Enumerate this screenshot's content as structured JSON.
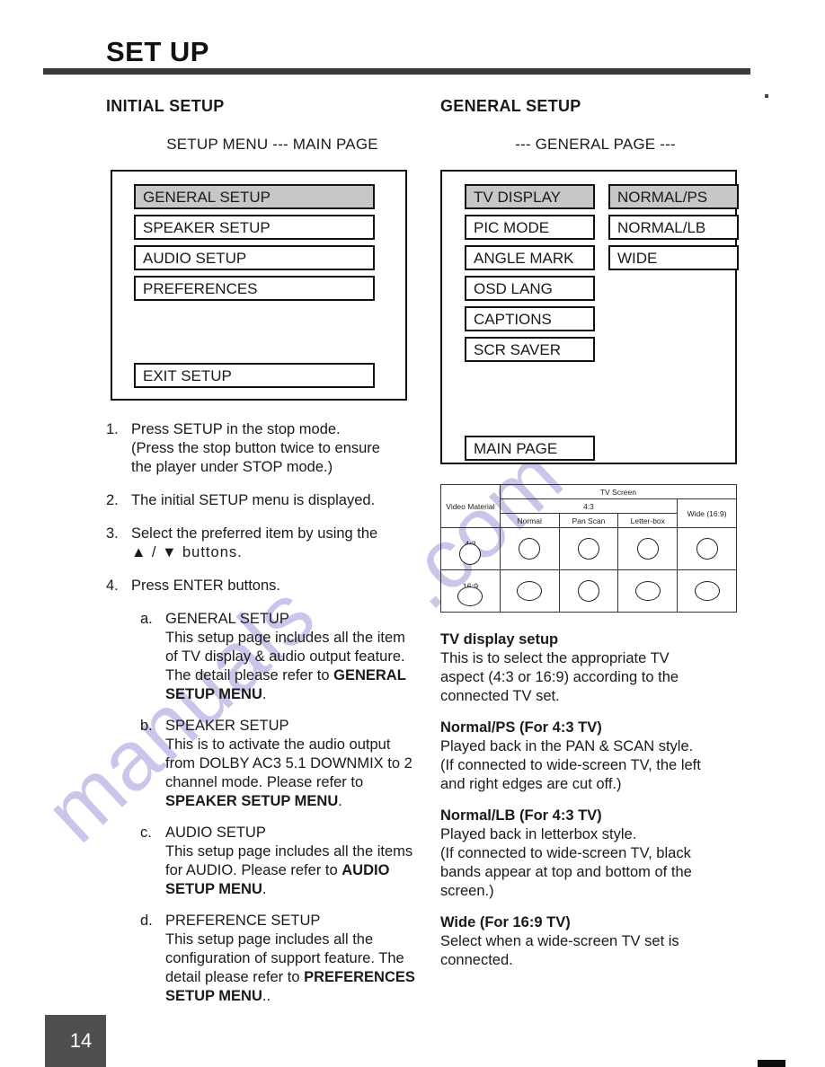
{
  "document": {
    "title": "SET UP",
    "page_number": "14"
  },
  "watermark": {
    "line1": "manuals",
    "line2": ".com"
  },
  "left_column": {
    "heading_part1": "INITIAL ",
    "heading_part2": "SETUP",
    "menu_caption": "SETUP MENU --- MAIN PAGE",
    "osd_menu": {
      "items": [
        {
          "label": "GENERAL SETUP",
          "highlighted": true
        },
        {
          "label": "SPEAKER SETUP",
          "highlighted": false
        },
        {
          "label": "AUDIO SETUP",
          "highlighted": false
        },
        {
          "label": "PREFERENCES",
          "highlighted": false
        }
      ],
      "exit_label": "EXIT SETUP"
    },
    "steps": [
      {
        "num": "1.",
        "lines": [
          "Press SETUP in the stop mode.",
          "(Press the stop button twice to ensure",
          "the player under STOP mode.)"
        ]
      },
      {
        "num": "2.",
        "lines": [
          "The initial SETUP menu is displayed."
        ]
      },
      {
        "num": "3.",
        "lines": [
          "Select the preferred item by using the",
          "▲ / ▼ buttons."
        ]
      },
      {
        "num": "4.",
        "lines": [
          "Press ENTER buttons."
        ]
      }
    ],
    "sub_items": [
      {
        "letter": "a.",
        "title": "GENERAL SETUP",
        "body": "This setup page includes all the item of TV display & audio output feature.  The detail please refer to ",
        "bold": "GENERAL SETUP MENU",
        "tail": "."
      },
      {
        "letter": "b.",
        "title": "SPEAKER SETUP",
        "body": "This is to activate the audio output from DOLBY AC3 5.1 DOWNMIX to 2 channel mode.  Please refer to ",
        "bold": "SPEAKER SETUP MENU",
        "tail": "."
      },
      {
        "letter": "c.",
        "title": "AUDIO SETUP",
        "body": "This setup page includes all the items for AUDIO.  Please refer to ",
        "bold": "AUDIO SETUP MENU",
        "tail": "."
      },
      {
        "letter": "d.",
        "title": "PREFERENCE SETUP",
        "body": "This setup page includes all the configuration of support feature. The detail please refer to ",
        "bold": "PREFERENCES SETUP MENU",
        "tail": ".."
      }
    ]
  },
  "right_column": {
    "heading_part1": "GENERAL ",
    "heading_part2": "SETUP",
    "menu_caption": "--- GENERAL PAGE ---",
    "osd_menu": {
      "items": [
        {
          "label": "TV DISPLAY",
          "highlighted": true
        },
        {
          "label": "PIC MODE",
          "highlighted": false
        },
        {
          "label": "ANGLE MARK",
          "highlighted": false
        },
        {
          "label": "OSD LANG",
          "highlighted": false
        },
        {
          "label": "CAPTIONS",
          "highlighted": false
        },
        {
          "label": "SCR SAVER",
          "highlighted": false
        }
      ],
      "options": [
        {
          "label": "NORMAL/PS",
          "highlighted": true
        },
        {
          "label": "NORMAL/LB",
          "highlighted": false
        },
        {
          "label": "WIDE",
          "highlighted": false
        }
      ],
      "main_page_label": "MAIN PAGE"
    },
    "tv_table": {
      "corner_label": "Video Material",
      "screen_header": "TV Screen",
      "group_4_3": "4:3",
      "group_wide": "Wide (16:9)",
      "sub_headers": [
        "Normal",
        "Pan Scan",
        "Letter-box"
      ],
      "row_labels": [
        "4:3",
        "16:9"
      ]
    },
    "sections": [
      {
        "heading": "TV display setup",
        "lines": [
          "This is to select the appropriate TV",
          "aspect (4:3 or 16:9) according to the",
          "connected TV set."
        ]
      },
      {
        "heading": "Normal/PS (For 4:3 TV)",
        "lines": [
          "Played back in the PAN & SCAN style.",
          "(If connected to wide-screen TV, the left",
          "and right edges are cut off.)"
        ]
      },
      {
        "heading": "Normal/LB (For 4:3 TV)",
        "lines": [
          "Played back in letterbox style.",
          "(If connected to wide-screen TV, black",
          "bands appear at top and bottom of the",
          "screen.)"
        ]
      },
      {
        "heading": "Wide (For 16:9 TV)",
        "lines": [
          "Select when a wide-screen TV set is",
          "connected."
        ]
      }
    ]
  }
}
